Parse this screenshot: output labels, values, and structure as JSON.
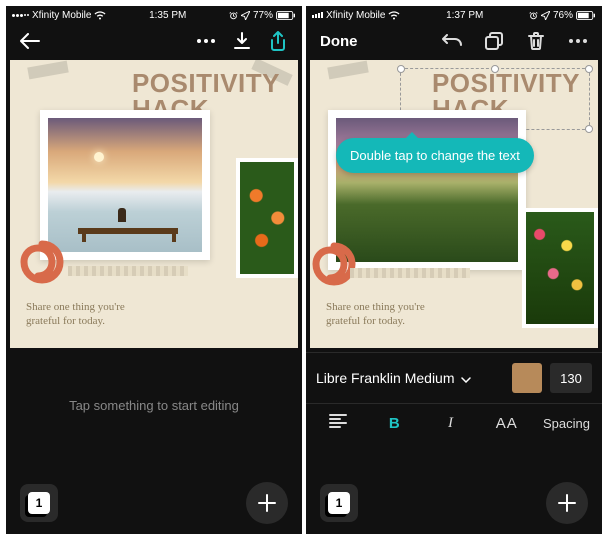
{
  "left": {
    "status": {
      "carrier": "Xfinity Mobile",
      "time": "1:35 PM",
      "battery": "77%"
    },
    "canvas": {
      "title_line1": "POSITIVITY",
      "title_line2": "HACK",
      "caption_line1": "Share one thing you're",
      "caption_line2": "grateful for today."
    },
    "hint": "Tap something to start editing",
    "page_count": "1"
  },
  "right": {
    "status": {
      "carrier": "Xfinity Mobile",
      "time": "1:37 PM",
      "battery": "76%"
    },
    "done": "Done",
    "canvas": {
      "title_line1": "POSITIVITY",
      "title_line2": "HACK",
      "tooltip": "Double tap to change the text",
      "caption_line1": "Share one thing you're",
      "caption_line2": "grateful for today."
    },
    "font": {
      "name": "Libre Franklin Medium",
      "size": "130",
      "color": "#b78a5a"
    },
    "tools": {
      "bold": "B",
      "italic": "I",
      "caps": "AA",
      "spacing": "Spacing"
    },
    "page_count": "1"
  }
}
